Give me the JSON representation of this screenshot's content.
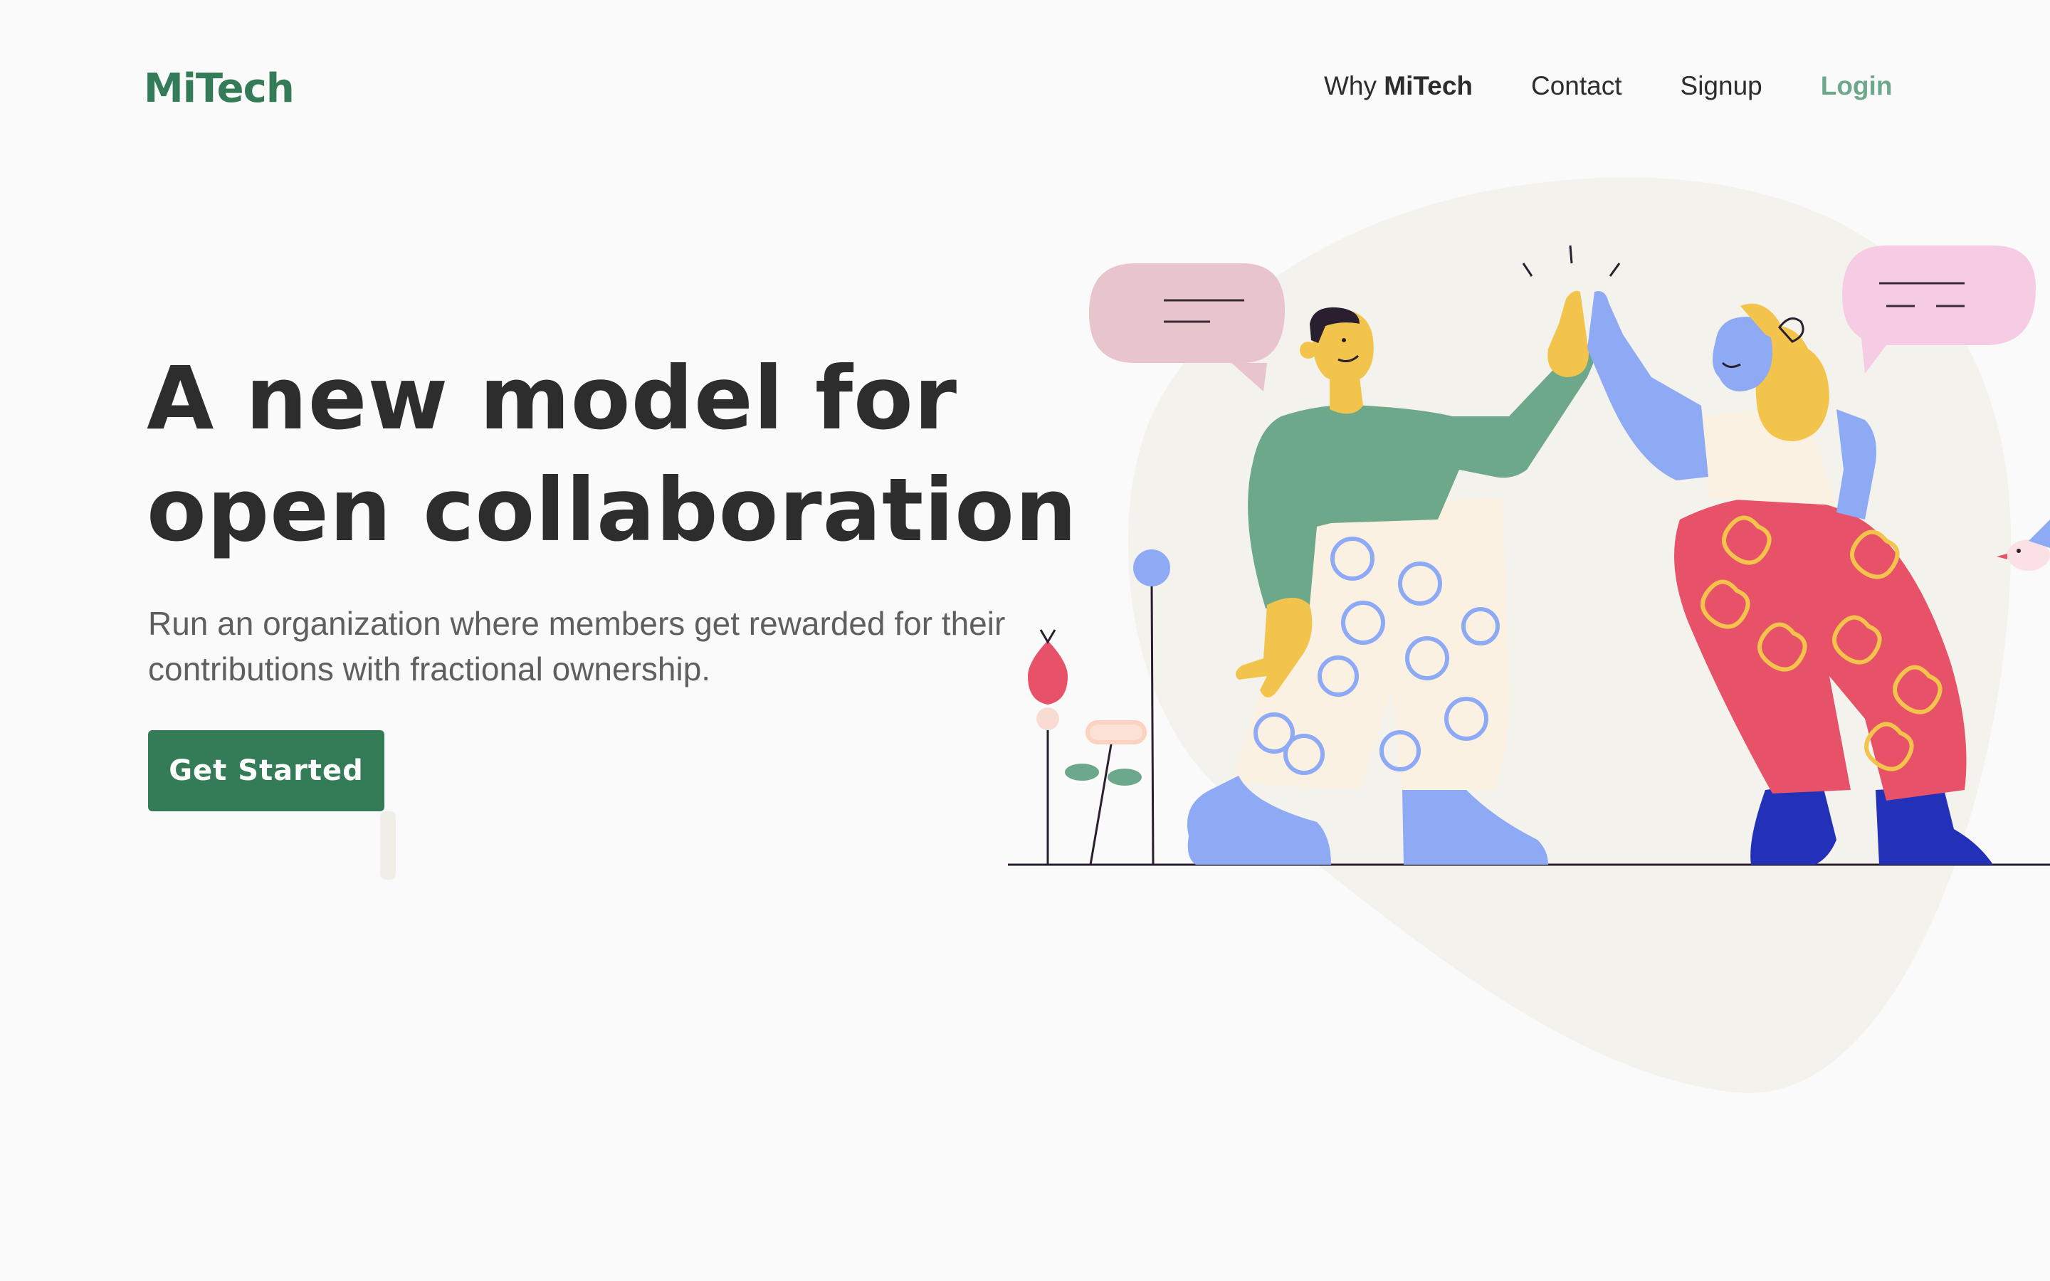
{
  "header": {
    "logo": "MiTech",
    "nav": {
      "why_prefix": "Why ",
      "why_brand": "MiTech",
      "contact": "Contact",
      "signup": "Signup",
      "login": "Login"
    }
  },
  "hero": {
    "headline_line1": "A new model for",
    "headline_line2": "open collaboration",
    "subtitle": "Run an organization where members get rewarded for their contributions with fractional ownership.",
    "cta_label": "Get Started"
  },
  "colors": {
    "brand": "#347b57",
    "login_accent": "#6ea88b",
    "text_dark": "#2d2d2d",
    "text_muted": "#5f5f5f",
    "background": "#fafafa"
  },
  "icons": [
    "high-five-illustration",
    "speech-bubble-icon",
    "flower-icon",
    "bird-icon"
  ]
}
